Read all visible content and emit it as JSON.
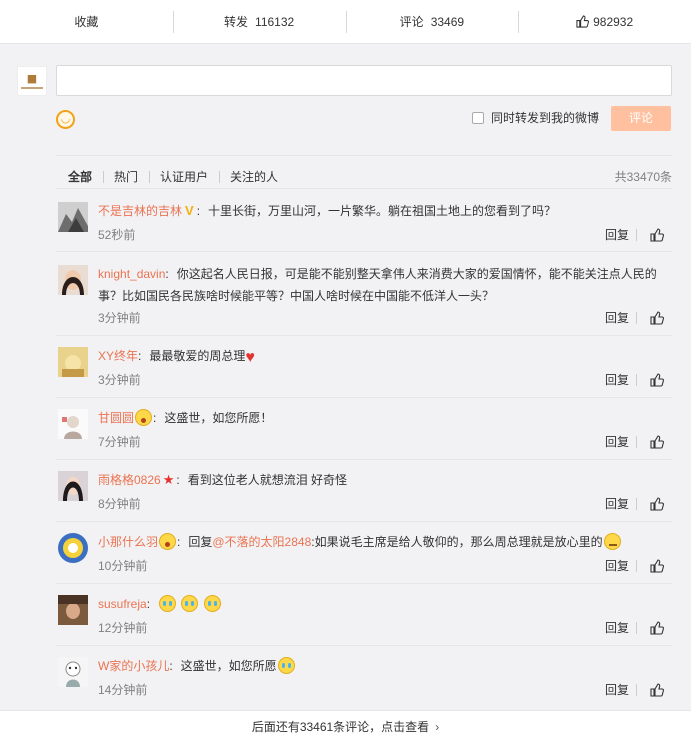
{
  "actions": {
    "favorite_label": "收藏",
    "repost_label": "转发",
    "repost_count": "116132",
    "comment_label": "评论",
    "comment_count": "33469",
    "like_count": "982932"
  },
  "composer": {
    "placeholder": "",
    "repost_checkbox_label": "同时转发到我的微博",
    "submit_label": "评论"
  },
  "tabs": [
    "全部",
    "热门",
    "认证用户",
    "关注的人"
  ],
  "total_label": "共33470条",
  "comments": [
    {
      "user": "不是吉林的吉林",
      "text": "十里长街，万里山河，一片繁华。躺在祖国土地上的您看到了吗？",
      "time": "52秒前"
    },
    {
      "user": "knight_davin",
      "text": "你这起名人民日报，可是能不能别整天拿伟人来消费大家的爱国情怀，能不能关注点人民的事？比如国民各民族啥时候能平等？中国人啥时候在中国能不低洋人一头？",
      "time": "3分钟前"
    },
    {
      "user": "XY终年",
      "text": "最最敬爱的周总理",
      "time": "3分钟前"
    },
    {
      "user": "甘圆圆",
      "text": "这盛世，如您所愿！",
      "time": "7分钟前"
    },
    {
      "user": "雨格格0826",
      "text": "看到这位老人就想流泪 好奇怪",
      "time": "8分钟前"
    },
    {
      "user": "小那什么羽",
      "reply_prefix": "回复",
      "mention": "@不落的太阳2848",
      "text": ":如果说毛主席是给人敬仰的，那么周总理就是放心里的",
      "time": "10分钟前"
    },
    {
      "user": "susufreja",
      "text": "",
      "time": "12分钟前"
    },
    {
      "user": "W家的小孩儿",
      "text": "这盛世，如您所愿",
      "time": "14分钟前"
    }
  ],
  "reply_label": "回复",
  "footer": {
    "more_label": "后面还有33461条评论，点击查看"
  },
  "colors": {
    "accent": "#eb7350",
    "submit_bg": "#ffc09f",
    "background": "#f2f2f5"
  }
}
